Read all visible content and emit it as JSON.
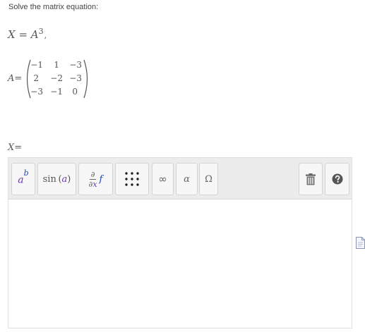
{
  "instruction": "Solve the matrix equation:",
  "equation": {
    "lhs": "X = A",
    "exponent": "3",
    "suffix": ","
  },
  "matrix": {
    "label": "A=",
    "rows": [
      [
        "−1",
        "1",
        "−3"
      ],
      [
        "2",
        "−2",
        "−3"
      ],
      [
        "−3",
        "−1",
        "0"
      ]
    ]
  },
  "answer": {
    "label": "X="
  },
  "toolbar": {
    "power": {
      "base": "a",
      "exp": "b"
    },
    "function": {
      "name": "sin",
      "open": "(",
      "arg": "a",
      "close": ")"
    },
    "derivative": {
      "num": "∂",
      "den_prefix": "∂",
      "den_var": "x",
      "fn": "f"
    },
    "infinity": "∞",
    "alpha": "α",
    "omega": "Ω"
  },
  "icons": {
    "matrix": "grid-dots-icon",
    "trash": "trash-icon",
    "help": "help-icon",
    "side": "document-icon"
  },
  "colors": {
    "toolbar_bg": "#ececec",
    "purple_var": "#6a3ab0",
    "blue_var": "#1f3fb8",
    "text": "#555555"
  }
}
